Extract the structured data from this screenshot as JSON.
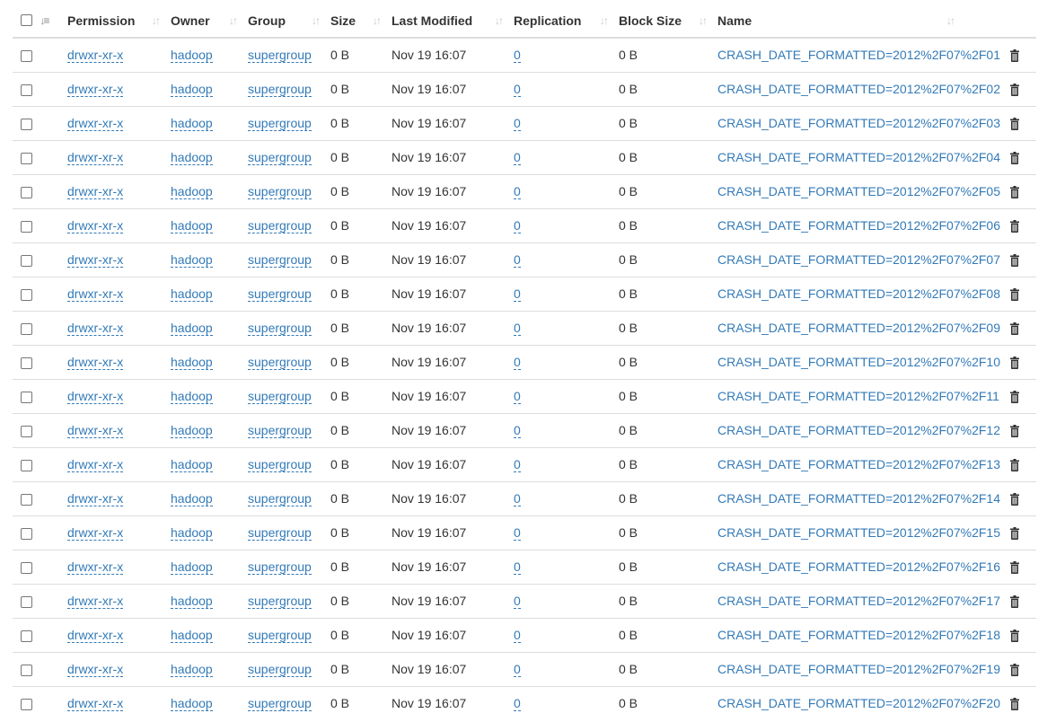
{
  "headers": {
    "permission": "Permission",
    "owner": "Owner",
    "group": "Group",
    "size": "Size",
    "last_modified": "Last Modified",
    "replication": "Replication",
    "block_size": "Block Size",
    "name": "Name"
  },
  "icons": {
    "sort": "sort-icon",
    "sort_active": "sort-amount-asc-icon",
    "delete": "trash-icon"
  },
  "colors": {
    "link": "#337ab7",
    "text": "#333333",
    "border": "#dddddd",
    "sort_icon": "#c8c8c8"
  },
  "rows": [
    {
      "permission": "drwxr-xr-x",
      "owner": "hadoop",
      "group": "supergroup",
      "size": "0 B",
      "last_modified": "Nov 19 16:07",
      "replication": "0",
      "block_size": "0 B",
      "name": "CRASH_DATE_FORMATTED=2012%2F07%2F01"
    },
    {
      "permission": "drwxr-xr-x",
      "owner": "hadoop",
      "group": "supergroup",
      "size": "0 B",
      "last_modified": "Nov 19 16:07",
      "replication": "0",
      "block_size": "0 B",
      "name": "CRASH_DATE_FORMATTED=2012%2F07%2F02"
    },
    {
      "permission": "drwxr-xr-x",
      "owner": "hadoop",
      "group": "supergroup",
      "size": "0 B",
      "last_modified": "Nov 19 16:07",
      "replication": "0",
      "block_size": "0 B",
      "name": "CRASH_DATE_FORMATTED=2012%2F07%2F03"
    },
    {
      "permission": "drwxr-xr-x",
      "owner": "hadoop",
      "group": "supergroup",
      "size": "0 B",
      "last_modified": "Nov 19 16:07",
      "replication": "0",
      "block_size": "0 B",
      "name": "CRASH_DATE_FORMATTED=2012%2F07%2F04"
    },
    {
      "permission": "drwxr-xr-x",
      "owner": "hadoop",
      "group": "supergroup",
      "size": "0 B",
      "last_modified": "Nov 19 16:07",
      "replication": "0",
      "block_size": "0 B",
      "name": "CRASH_DATE_FORMATTED=2012%2F07%2F05"
    },
    {
      "permission": "drwxr-xr-x",
      "owner": "hadoop",
      "group": "supergroup",
      "size": "0 B",
      "last_modified": "Nov 19 16:07",
      "replication": "0",
      "block_size": "0 B",
      "name": "CRASH_DATE_FORMATTED=2012%2F07%2F06"
    },
    {
      "permission": "drwxr-xr-x",
      "owner": "hadoop",
      "group": "supergroup",
      "size": "0 B",
      "last_modified": "Nov 19 16:07",
      "replication": "0",
      "block_size": "0 B",
      "name": "CRASH_DATE_FORMATTED=2012%2F07%2F07"
    },
    {
      "permission": "drwxr-xr-x",
      "owner": "hadoop",
      "group": "supergroup",
      "size": "0 B",
      "last_modified": "Nov 19 16:07",
      "replication": "0",
      "block_size": "0 B",
      "name": "CRASH_DATE_FORMATTED=2012%2F07%2F08"
    },
    {
      "permission": "drwxr-xr-x",
      "owner": "hadoop",
      "group": "supergroup",
      "size": "0 B",
      "last_modified": "Nov 19 16:07",
      "replication": "0",
      "block_size": "0 B",
      "name": "CRASH_DATE_FORMATTED=2012%2F07%2F09"
    },
    {
      "permission": "drwxr-xr-x",
      "owner": "hadoop",
      "group": "supergroup",
      "size": "0 B",
      "last_modified": "Nov 19 16:07",
      "replication": "0",
      "block_size": "0 B",
      "name": "CRASH_DATE_FORMATTED=2012%2F07%2F10"
    },
    {
      "permission": "drwxr-xr-x",
      "owner": "hadoop",
      "group": "supergroup",
      "size": "0 B",
      "last_modified": "Nov 19 16:07",
      "replication": "0",
      "block_size": "0 B",
      "name": "CRASH_DATE_FORMATTED=2012%2F07%2F11"
    },
    {
      "permission": "drwxr-xr-x",
      "owner": "hadoop",
      "group": "supergroup",
      "size": "0 B",
      "last_modified": "Nov 19 16:07",
      "replication": "0",
      "block_size": "0 B",
      "name": "CRASH_DATE_FORMATTED=2012%2F07%2F12"
    },
    {
      "permission": "drwxr-xr-x",
      "owner": "hadoop",
      "group": "supergroup",
      "size": "0 B",
      "last_modified": "Nov 19 16:07",
      "replication": "0",
      "block_size": "0 B",
      "name": "CRASH_DATE_FORMATTED=2012%2F07%2F13"
    },
    {
      "permission": "drwxr-xr-x",
      "owner": "hadoop",
      "group": "supergroup",
      "size": "0 B",
      "last_modified": "Nov 19 16:07",
      "replication": "0",
      "block_size": "0 B",
      "name": "CRASH_DATE_FORMATTED=2012%2F07%2F14"
    },
    {
      "permission": "drwxr-xr-x",
      "owner": "hadoop",
      "group": "supergroup",
      "size": "0 B",
      "last_modified": "Nov 19 16:07",
      "replication": "0",
      "block_size": "0 B",
      "name": "CRASH_DATE_FORMATTED=2012%2F07%2F15"
    },
    {
      "permission": "drwxr-xr-x",
      "owner": "hadoop",
      "group": "supergroup",
      "size": "0 B",
      "last_modified": "Nov 19 16:07",
      "replication": "0",
      "block_size": "0 B",
      "name": "CRASH_DATE_FORMATTED=2012%2F07%2F16"
    },
    {
      "permission": "drwxr-xr-x",
      "owner": "hadoop",
      "group": "supergroup",
      "size": "0 B",
      "last_modified": "Nov 19 16:07",
      "replication": "0",
      "block_size": "0 B",
      "name": "CRASH_DATE_FORMATTED=2012%2F07%2F17"
    },
    {
      "permission": "drwxr-xr-x",
      "owner": "hadoop",
      "group": "supergroup",
      "size": "0 B",
      "last_modified": "Nov 19 16:07",
      "replication": "0",
      "block_size": "0 B",
      "name": "CRASH_DATE_FORMATTED=2012%2F07%2F18"
    },
    {
      "permission": "drwxr-xr-x",
      "owner": "hadoop",
      "group": "supergroup",
      "size": "0 B",
      "last_modified": "Nov 19 16:07",
      "replication": "0",
      "block_size": "0 B",
      "name": "CRASH_DATE_FORMATTED=2012%2F07%2F19"
    },
    {
      "permission": "drwxr-xr-x",
      "owner": "hadoop",
      "group": "supergroup",
      "size": "0 B",
      "last_modified": "Nov 19 16:07",
      "replication": "0",
      "block_size": "0 B",
      "name": "CRASH_DATE_FORMATTED=2012%2F07%2F20"
    }
  ]
}
